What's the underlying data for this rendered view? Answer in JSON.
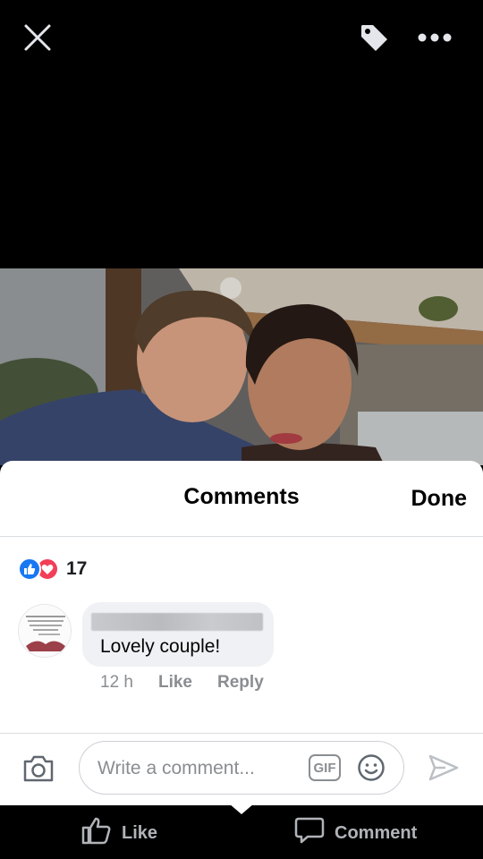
{
  "topbar": {
    "close_icon": "close-icon",
    "tag_icon": "tag-icon",
    "more_icon": "more-icon"
  },
  "sheet": {
    "title": "Comments",
    "done_label": "Done"
  },
  "reactions": {
    "icons": [
      "like-reaction-icon",
      "love-reaction-icon"
    ],
    "count": "17"
  },
  "comment": {
    "text": "Lovely couple!",
    "time": "12 h",
    "like_label": "Like",
    "reply_label": "Reply"
  },
  "composer": {
    "placeholder": "Write a comment...",
    "gif_label": "GIF"
  },
  "bottom_bar": {
    "like_label": "Like",
    "comment_label": "Comment"
  },
  "colors": {
    "like_blue": "#1877f2",
    "love_red": "#f33e58",
    "muted_gray": "#8a8d91"
  }
}
